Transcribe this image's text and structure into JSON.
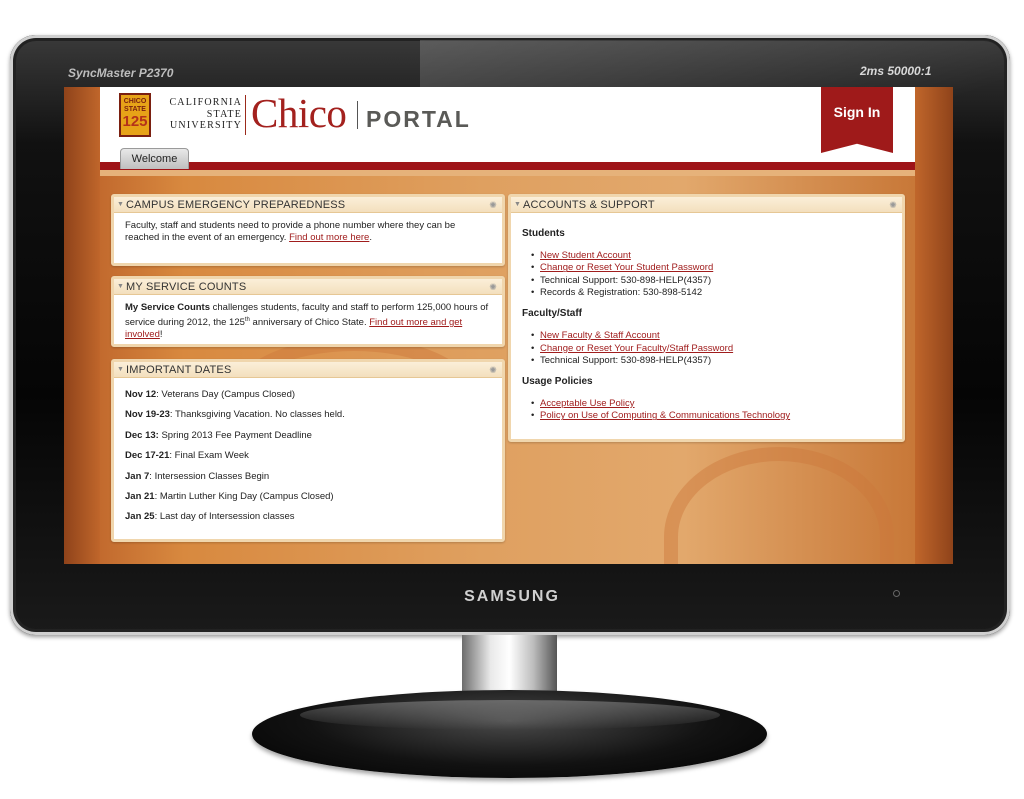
{
  "monitor": {
    "model": "SyncMaster P2370",
    "spec": "2ms  50000:1",
    "brand": "SAMSUNG"
  },
  "header": {
    "badge_top": "CHICO STATE",
    "badge_num": "125",
    "csu_line1": "CALIFORNIA",
    "csu_line2": "STATE",
    "csu_line3": "UNIVERSITY",
    "chico": "Chico",
    "portal": "PORTAL",
    "sign_in": "Sign In",
    "tab_welcome": "Welcome"
  },
  "emergency": {
    "title": "CAMPUS EMERGENCY PREPAREDNESS",
    "text": "Faculty, staff and students need to provide a phone number where they can be reached in the event of an emergency.",
    "link": "Find out more here",
    "after": "."
  },
  "service": {
    "title": "MY SERVICE COUNTS",
    "bold": "My Service Counts",
    "text": " challenges students, faculty and staff to perform 125,000 hours of service during 2012, the 125",
    "sup": "th",
    "text2": " anniversary of Chico State.",
    "link": "Find out more and get involved",
    "after": "!"
  },
  "dates": {
    "title": "IMPORTANT DATES",
    "items": [
      {
        "date": "Nov 12",
        "text": ": Veterans Day (Campus Closed)"
      },
      {
        "date": "Nov 19-23",
        "text": ": Thanksgiving Vacation. No classes held."
      },
      {
        "date": "Dec 13:",
        "text": " Spring 2013 Fee Payment Deadline"
      },
      {
        "date": "Dec 17-21",
        "text": ": Final Exam Week"
      },
      {
        "date": "Jan 7",
        "text": ": Intersession Classes Begin"
      },
      {
        "date": "Jan 21",
        "text": ": Martin Luther King Day (Campus Closed)"
      },
      {
        "date": "Jan 25",
        "text": ": Last day of Intersession classes"
      }
    ]
  },
  "accounts": {
    "title": "ACCOUNTS & SUPPORT",
    "students_heading": "Students",
    "students": {
      "new_account": "New Student Account",
      "reset_password": "Change or Reset Your Student Password",
      "tech_support": "Technical Support: 530-898-HELP(4357)",
      "records": "Records & Registration: 530-898-5142"
    },
    "faculty_heading": "Faculty/Staff",
    "faculty": {
      "new_account": "New Faculty & Staff Account",
      "reset_password": "Change or Reset Your Faculty/Staff Password",
      "tech_support": "Technical Support: 530-898-HELP(4357)"
    },
    "policies_heading": "Usage Policies",
    "policies": {
      "acceptable_use": "Acceptable Use Policy",
      "computing": "Policy on Use of Computing & Communications Technology"
    }
  }
}
